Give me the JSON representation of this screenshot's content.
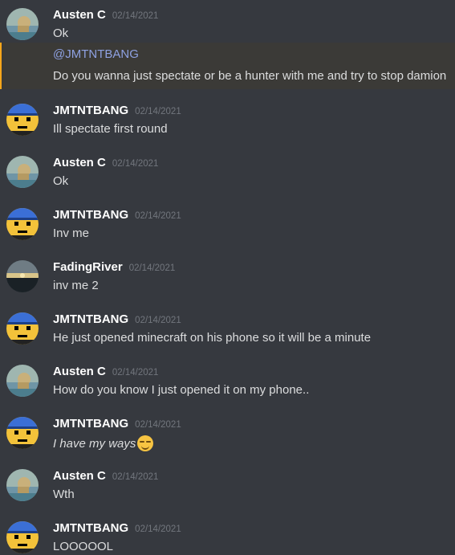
{
  "messages": [
    {
      "author": "Austen C",
      "timestamp": "02/14/2021",
      "avatar": "austen-avatar",
      "lines": [
        "Ok"
      ]
    },
    {
      "mention": "@JMTNTBANG",
      "line": "Do you wanna just spectate or be a hunter with me and try to stop damion"
    },
    {
      "author": "JMTNTBANG",
      "timestamp": "02/14/2021",
      "avatar": "jmtntbang-avatar",
      "lines": [
        "Ill spectate first round"
      ]
    },
    {
      "author": "Austen C",
      "timestamp": "02/14/2021",
      "avatar": "austen-avatar",
      "lines": [
        "Ok"
      ]
    },
    {
      "author": "JMTNTBANG",
      "timestamp": "02/14/2021",
      "avatar": "jmtntbang-avatar",
      "lines": [
        "Inv me"
      ]
    },
    {
      "author": "FadingRiver",
      "timestamp": "02/14/2021",
      "avatar": "fadingriver-avatar",
      "lines": [
        "inv me 2"
      ]
    },
    {
      "author": "JMTNTBANG",
      "timestamp": "02/14/2021",
      "avatar": "jmtntbang-avatar",
      "lines": [
        "He just opened minecraft on his phone so it will be a minute"
      ]
    },
    {
      "author": "Austen C",
      "timestamp": "02/14/2021",
      "avatar": "austen-avatar",
      "lines": [
        "How do you know I just opened it on my phone.."
      ]
    },
    {
      "author": "JMTNTBANG",
      "timestamp": "02/14/2021",
      "avatar": "jmtntbang-avatar",
      "lines": [
        "I have my ways"
      ],
      "emoji": "smirk-emoji"
    },
    {
      "author": "Austen C",
      "timestamp": "02/14/2021",
      "avatar": "austen-avatar",
      "lines": [
        "Wth"
      ]
    },
    {
      "author": "JMTNTBANG",
      "timestamp": "02/14/2021",
      "avatar": "jmtntbang-avatar",
      "lines": [
        "LOOOOOL"
      ]
    }
  ],
  "colors": {
    "background": "#36393f",
    "mention": "#8ea1e1",
    "highlight_bar": "#faa61a"
  }
}
